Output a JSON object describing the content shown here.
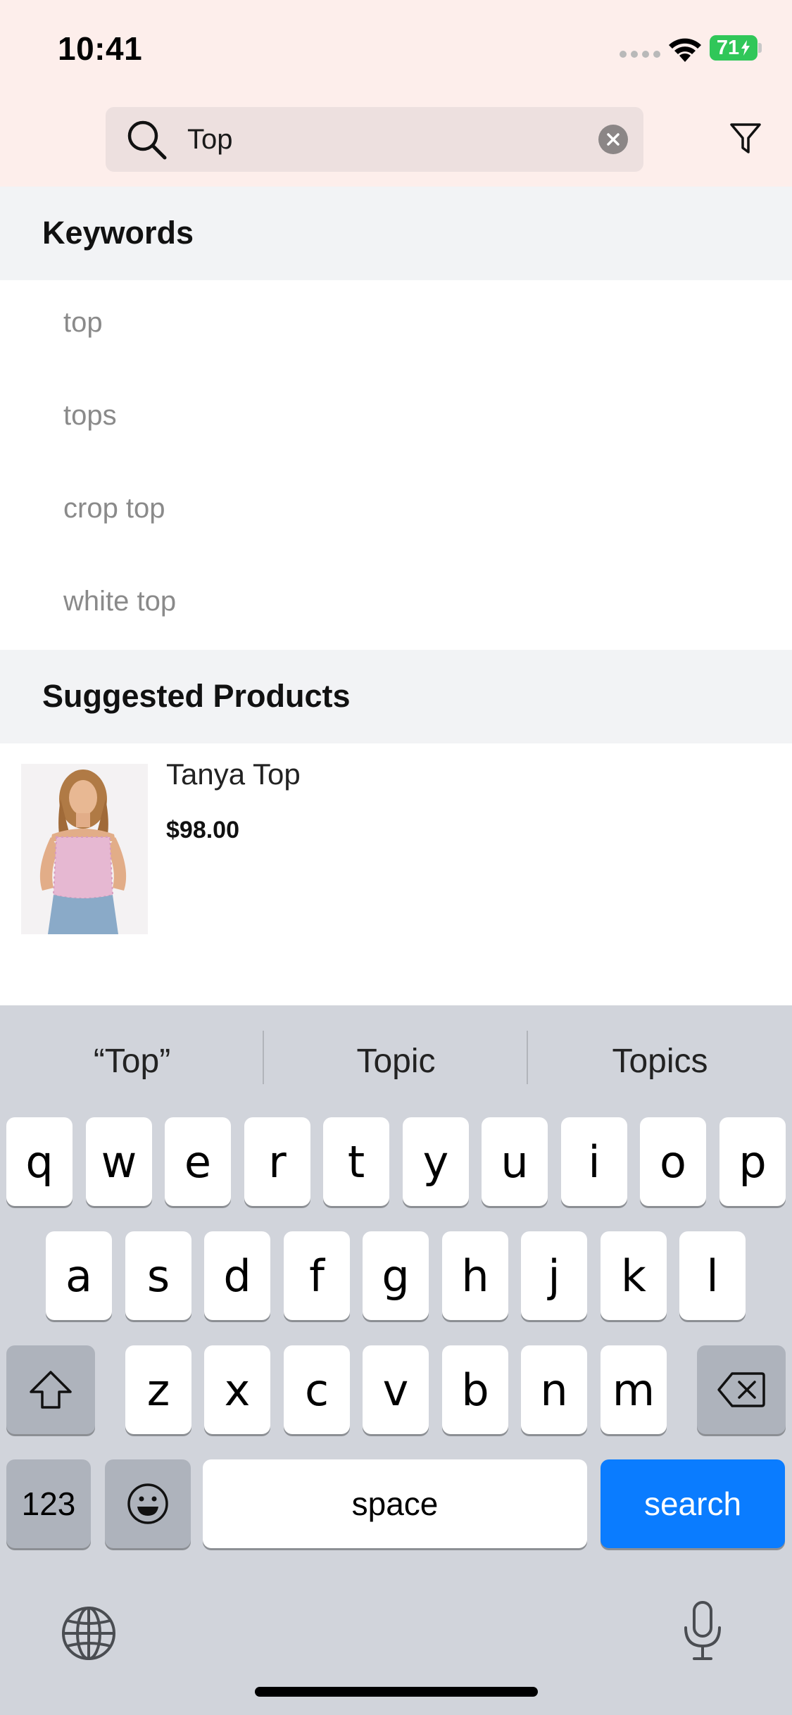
{
  "status_bar": {
    "time": "10:41",
    "battery": "71"
  },
  "search": {
    "query": "Top"
  },
  "keywords": {
    "title": "Keywords",
    "items": [
      "top",
      "tops",
      "crop top",
      "white top"
    ]
  },
  "suggested": {
    "title": "Suggested Products",
    "products": [
      {
        "name": "Tanya Top",
        "price": "$98.00"
      }
    ]
  },
  "keyboard": {
    "suggestions": [
      "“Top”",
      "Topic",
      "Topics"
    ],
    "row1": [
      "q",
      "w",
      "e",
      "r",
      "t",
      "y",
      "u",
      "i",
      "o",
      "p"
    ],
    "row2": [
      "a",
      "s",
      "d",
      "f",
      "g",
      "h",
      "j",
      "k",
      "l"
    ],
    "row3": [
      "z",
      "x",
      "c",
      "v",
      "b",
      "n",
      "m"
    ],
    "numbers_label": "123",
    "space_label": "space",
    "search_label": "search"
  },
  "colors": {
    "header_bg": "#fdeeeb",
    "section_bg": "#f2f3f5",
    "search_key": "#0a7cff",
    "battery": "#30c759"
  }
}
